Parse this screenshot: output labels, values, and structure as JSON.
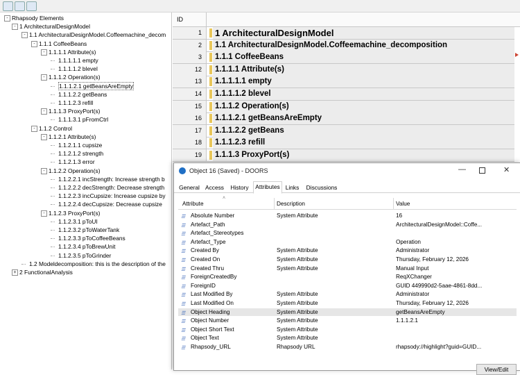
{
  "toolbar": {
    "icons": [
      "save-icon",
      "folder-icon",
      "edit-icon"
    ]
  },
  "tree": {
    "nodes": [
      {
        "label": "Rhapsody Elements",
        "level": 0,
        "box": "-"
      },
      {
        "label": "1 ArchitecturalDesignModel",
        "level": 1,
        "box": "-"
      },
      {
        "label": "1.1 ArchitecturalDesignModel.Coffeemachine_decom",
        "level": 2,
        "box": "-"
      },
      {
        "label": "1.1.1 CoffeeBeans",
        "level": 3,
        "box": "-"
      },
      {
        "label": "1.1.1.1 Attribute(s)",
        "level": 4,
        "box": "-"
      },
      {
        "label": "1.1.1.1.1 empty",
        "level": 5,
        "box": ""
      },
      {
        "label": "1.1.1.1.2 blevel",
        "level": 5,
        "box": ""
      },
      {
        "label": "1.1.1.2 Operation(s)",
        "level": 4,
        "box": "-"
      },
      {
        "label": "1.1.1.2.1 getBeansAreEmpty",
        "level": 5,
        "box": "",
        "selected": true
      },
      {
        "label": "1.1.1.2.2 getBeans",
        "level": 5,
        "box": ""
      },
      {
        "label": "1.1.1.2.3 refill",
        "level": 5,
        "box": ""
      },
      {
        "label": "1.1.1.3 ProxyPort(s)",
        "level": 4,
        "box": "-"
      },
      {
        "label": "1.1.1.3.1 pFromCtrl",
        "level": 5,
        "box": ""
      },
      {
        "label": "1.1.2 Control",
        "level": 3,
        "box": "-"
      },
      {
        "label": "1.1.2.1 Attribute(s)",
        "level": 4,
        "box": "-"
      },
      {
        "label": "1.1.2.1.1 cupsize",
        "level": 5,
        "box": ""
      },
      {
        "label": "1.1.2.1.2 strength",
        "level": 5,
        "box": ""
      },
      {
        "label": "1.1.2.1.3 error",
        "level": 5,
        "box": ""
      },
      {
        "label": "1.1.2.2 Operation(s)",
        "level": 4,
        "box": "-"
      },
      {
        "label": "1.1.2.2.1 incStrength: Increase strength b",
        "level": 5,
        "box": ""
      },
      {
        "label": "1.1.2.2.2 decStrength: Decrease strength",
        "level": 5,
        "box": ""
      },
      {
        "label": "1.1.2.2.3 incCupsize: Increase cupsize by",
        "level": 5,
        "box": ""
      },
      {
        "label": "1.1.2.2.4 decCupsize: Decrease cupsize",
        "level": 5,
        "box": ""
      },
      {
        "label": "1.1.2.3 ProxyPort(s)",
        "level": 4,
        "box": "-"
      },
      {
        "label": "1.1.2.3.1 pToUI",
        "level": 5,
        "box": ""
      },
      {
        "label": "1.1.2.3.2 pToWaterTank",
        "level": 5,
        "box": ""
      },
      {
        "label": "1.1.2.3.3 pToCoffeeBeans",
        "level": 5,
        "box": ""
      },
      {
        "label": "1.1.2.3.4 pToBrewUnit",
        "level": 5,
        "box": ""
      },
      {
        "label": "1.1.2.3.5 pToGrinder",
        "level": 5,
        "box": ""
      },
      {
        "label": "1.2 Modeldecomposition: this is the description of the",
        "level": 2,
        "box": ""
      },
      {
        "label": "2 FunctionalAnalysis",
        "level": 1,
        "box": "+"
      }
    ]
  },
  "grid": {
    "id_header": "ID",
    "rows": [
      {
        "id": "1",
        "text": "1 ArchitecturalDesignModel",
        "big": true
      },
      {
        "id": "2",
        "text": "1.1 ArchitecturalDesignModel.Coffeemachine_decomposition"
      },
      {
        "id": "3",
        "text": "1.1.1 CoffeeBeans"
      },
      {
        "id": "12",
        "text": "1.1.1.1 Attribute(s)"
      },
      {
        "id": "13",
        "text": "1.1.1.1.1 empty"
      },
      {
        "id": "14",
        "text": "1.1.1.1.2 blevel"
      },
      {
        "id": "15",
        "text": "1.1.1.2 Operation(s)"
      },
      {
        "id": "16",
        "text": "1.1.1.2.1 getBeansAreEmpty"
      },
      {
        "id": "17",
        "text": "1.1.1.2.2 getBeans"
      },
      {
        "id": "18",
        "text": "1.1.1.2.3 refill"
      },
      {
        "id": "19",
        "text": "1.1.1.3 ProxyPort(s)"
      }
    ]
  },
  "dialog": {
    "title": "Object 16 (Saved) - DOORS",
    "tabs": [
      "General",
      "Access",
      "History",
      "Attributes",
      "Links",
      "Discussions"
    ],
    "active_tab": "Attributes",
    "headers": {
      "attribute": "Attribute",
      "description": "Description",
      "value": "Value"
    },
    "rows": [
      {
        "a": "Absolute Number",
        "d": "System Attribute",
        "v": "16"
      },
      {
        "a": "Artefact_Path",
        "d": "",
        "v": "ArchitecturalDesignModel::Coffe..."
      },
      {
        "a": "Artefact_Stereotypes",
        "d": "",
        "v": ""
      },
      {
        "a": "Artefact_Type",
        "d": "",
        "v": "Operation"
      },
      {
        "a": "Created By",
        "d": "System Attribute",
        "v": "Administrator"
      },
      {
        "a": "Created On",
        "d": "System Attribute",
        "v": "Thursday, February 12, 2026"
      },
      {
        "a": "Created Thru",
        "d": "System Attribute",
        "v": "Manual Input"
      },
      {
        "a": "ForeignCreatedBy",
        "d": "",
        "v": "ReqXChanger"
      },
      {
        "a": "ForeignID",
        "d": "",
        "v": "GUID 449990d2-5aae-4861-8dd..."
      },
      {
        "a": "Last Modified By",
        "d": "System Attribute",
        "v": "Administrator"
      },
      {
        "a": "Last Modified On",
        "d": "System Attribute",
        "v": "Thursday, February 12, 2026"
      },
      {
        "a": "Object Heading",
        "d": "System Attribute",
        "v": "getBeansAreEmpty",
        "selected": true
      },
      {
        "a": "Object Number",
        "d": "System Attribute",
        "v": "1.1.1.2.1"
      },
      {
        "a": "Object Short Text",
        "d": "System Attribute",
        "v": ""
      },
      {
        "a": "Object Text",
        "d": "System Attribute",
        "v": ""
      },
      {
        "a": "Rhapsody_URL",
        "d": "Rhapsody URL",
        "v": "rhapsody://highlight?guid=GUID..."
      }
    ],
    "view_edit_label": "View/Edit"
  },
  "colors": {
    "heading_bar": "#e8c65a",
    "row_bg": "#ececec",
    "accent": "#1f6fc5"
  }
}
